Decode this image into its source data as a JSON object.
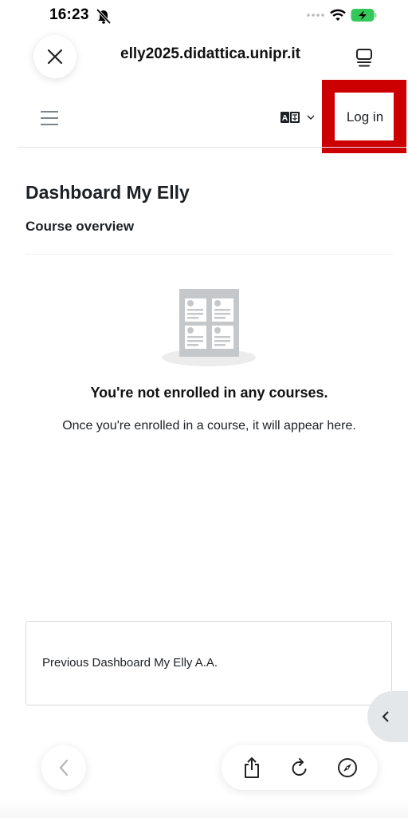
{
  "status_bar": {
    "time": "16:23",
    "icons": [
      "bell-slash-icon",
      "signal-dots-icon",
      "wifi-icon",
      "battery-charging-icon"
    ]
  },
  "browser": {
    "url": "elly2025.didattica.unipr.it",
    "icons": [
      "close-icon",
      "tabs-icon"
    ]
  },
  "header": {
    "menu_icon": "hamburger-icon",
    "language_icon": "language-icon",
    "login_label": "Log in",
    "highlight_color": "#cc0000"
  },
  "main": {
    "page_title": "Dashboard My Elly",
    "section_title": "Course overview",
    "empty_title": "You're not enrolled in any courses.",
    "empty_text": "Once you're enrolled in a course, it will appear here."
  },
  "block": {
    "link_label": "Previous Dashboard My Elly A.A."
  },
  "toolbar": {
    "icons": [
      "back-icon",
      "share-icon",
      "reload-icon",
      "compass-icon"
    ]
  }
}
